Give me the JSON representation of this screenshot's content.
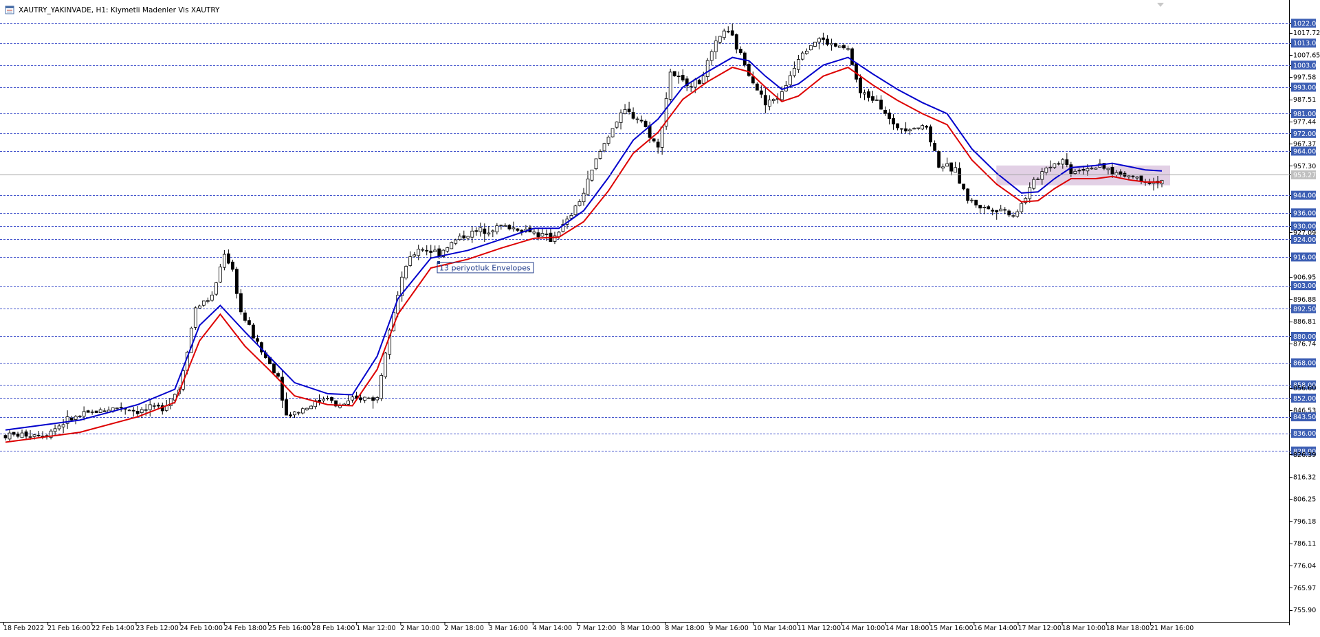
{
  "window": {
    "title": "XAUTRY_YAKINVADE, H1:  Kiymetli Madenler Vis XAUTRY",
    "title_icon": "chart-window-icon"
  },
  "colors": {
    "background": "#ffffff",
    "bull_candle": "#ffffff",
    "bear_candle": "#000000",
    "candle_outline": "#000000",
    "upper_envelope": "#0000cc",
    "lower_envelope": "#dd0000",
    "level_lines": "#4455cc",
    "price_highlight": "#3d5fb4",
    "current_price_line": "#a0a0a0",
    "current_price_box": "#c0c0c0",
    "zone_fill": "#d8c0dc"
  },
  "chart_data": {
    "type": "candlestick",
    "symbol": "XAUTRY_YAKINVADE",
    "timeframe": "H1",
    "ylim": [
      750.5,
      1026.0
    ],
    "grid": false,
    "x_labels": [
      "18 Feb 2022",
      "21 Feb 16:00",
      "22 Feb 14:00",
      "23 Feb 12:00",
      "24 Feb 10:00",
      "24 Feb 18:00",
      "25 Feb 16:00",
      "28 Feb 14:00",
      "1 Mar 12:00",
      "2 Mar 10:00",
      "2 Mar 18:00",
      "3 Mar 16:00",
      "4 Mar 14:00",
      "7 Mar 12:00",
      "8 Mar 10:00",
      "8 Mar 18:00",
      "9 Mar 16:00",
      "10 Mar 14:00",
      "11 Mar 12:00",
      "14 Mar 10:00",
      "14 Mar 18:00",
      "15 Mar 16:00",
      "16 Mar 14:00",
      "17 Mar 12:00",
      "18 Mar 10:00",
      "18 Mar 18:00",
      "21 Mar 16:00"
    ],
    "y_ticks": [
      "1022.00",
      "1017.72",
      "1013.00",
      "1007.65",
      "1003.00",
      "997.58",
      "993.00",
      "987.51",
      "981.00",
      "977.44",
      "972.00",
      "967.37",
      "964.00",
      "957.30",
      "953.27",
      "944.00",
      "936.00",
      "930.00",
      "927.09",
      "924.00",
      "916.00",
      "906.95",
      "903.00",
      "896.88",
      "892.50",
      "886.81",
      "880.00",
      "876.74",
      "868.00",
      "858.00",
      "856.60",
      "852.00",
      "846.53",
      "843.50",
      "836.00",
      "828.00",
      "826.39",
      "816.32",
      "806.25",
      "796.18",
      "786.11",
      "776.04",
      "765.97",
      "755.90"
    ],
    "highlighted_levels": [
      "1022.00",
      "1013.00",
      "1003.00",
      "993.00",
      "981.00",
      "972.00",
      "964.00",
      "944.00",
      "936.00",
      "930.00",
      "924.00",
      "916.00",
      "903.00",
      "892.50",
      "880.00",
      "868.00",
      "858.00",
      "852.00",
      "843.50",
      "836.00",
      "828.00"
    ],
    "current_price": "953.27",
    "annotation": "13 periyotluk Envelopes",
    "zone": {
      "from_label": "16 Mar 14:00",
      "to_label": "21 Mar 16:00",
      "y_range": [
        948.5,
        957.5
      ]
    },
    "key_points": [
      [
        0,
        835
      ],
      [
        10,
        836
      ],
      [
        15,
        842
      ],
      [
        22,
        846
      ],
      [
        28,
        848
      ],
      [
        32,
        846
      ],
      [
        38,
        848
      ],
      [
        42,
        856
      ],
      [
        46,
        893
      ],
      [
        50,
        898
      ],
      [
        53,
        918
      ],
      [
        55,
        910
      ],
      [
        57,
        891
      ],
      [
        62,
        873
      ],
      [
        66,
        862
      ],
      [
        68,
        844
      ],
      [
        73,
        848
      ],
      [
        78,
        853
      ],
      [
        80,
        848
      ],
      [
        86,
        852
      ],
      [
        90,
        852
      ],
      [
        93,
        885
      ],
      [
        97,
        912
      ],
      [
        100,
        920
      ],
      [
        105,
        918
      ],
      [
        110,
        925
      ],
      [
        115,
        928
      ],
      [
        120,
        930
      ],
      [
        127,
        928
      ],
      [
        132,
        924
      ],
      [
        136,
        932
      ],
      [
        140,
        945
      ],
      [
        143,
        960
      ],
      [
        147,
        975
      ],
      [
        150,
        982
      ],
      [
        154,
        978
      ],
      [
        158,
        965
      ],
      [
        161,
        1000
      ],
      [
        164,
        995
      ],
      [
        168,
        995
      ],
      [
        172,
        1012
      ],
      [
        174,
        1019
      ],
      [
        176,
        1015
      ],
      [
        180,
        1000
      ],
      [
        184,
        985
      ],
      [
        188,
        990
      ],
      [
        191,
        1003
      ],
      [
        193,
        1010
      ],
      [
        197,
        1015
      ],
      [
        200,
        1012
      ],
      [
        204,
        1010
      ],
      [
        207,
        990
      ],
      [
        211,
        988
      ],
      [
        215,
        975
      ],
      [
        219,
        975
      ],
      [
        223,
        975
      ],
      [
        226,
        958
      ],
      [
        230,
        955
      ],
      [
        233,
        942
      ],
      [
        237,
        938
      ],
      [
        241,
        938
      ],
      [
        244,
        935
      ],
      [
        246,
        940
      ],
      [
        249,
        950
      ],
      [
        252,
        957
      ],
      [
        256,
        960
      ],
      [
        258,
        955
      ],
      [
        263,
        957
      ],
      [
        266,
        956
      ],
      [
        269,
        954
      ],
      [
        274,
        952
      ],
      [
        278,
        950
      ],
      [
        280,
        951
      ]
    ],
    "series": [
      {
        "name": "upper",
        "color": "#0000cc",
        "values": [
          [
            0,
            837.5
          ],
          [
            18,
            842.0
          ],
          [
            32,
            849.0
          ],
          [
            41,
            856.0
          ],
          [
            47,
            885.0
          ],
          [
            52,
            894.0
          ],
          [
            58,
            882.0
          ],
          [
            64,
            870.5
          ],
          [
            70,
            859.0
          ],
          [
            78,
            854.0
          ],
          [
            84,
            853.5
          ],
          [
            90,
            871.0
          ],
          [
            95,
            897.0
          ],
          [
            103,
            915.5
          ],
          [
            112,
            919.0
          ],
          [
            120,
            924.0
          ],
          [
            128,
            929.0
          ],
          [
            134,
            929.0
          ],
          [
            140,
            937.0
          ],
          [
            146,
            952.0
          ],
          [
            152,
            969.0
          ],
          [
            158,
            978.5
          ],
          [
            164,
            993.0
          ],
          [
            170,
            1000.0
          ],
          [
            176,
            1006.5
          ],
          [
            180,
            1005.0
          ],
          [
            184,
            998.0
          ],
          [
            188,
            992.0
          ],
          [
            192,
            994.5
          ],
          [
            198,
            1003.0
          ],
          [
            204,
            1006.5
          ],
          [
            210,
            999.0
          ],
          [
            216,
            992.0
          ],
          [
            222,
            986.0
          ],
          [
            228,
            981.0
          ],
          [
            234,
            965.0
          ],
          [
            240,
            954.0
          ],
          [
            246,
            945.0
          ],
          [
            250,
            945.5
          ],
          [
            254,
            951.5
          ],
          [
            258,
            956.5
          ],
          [
            264,
            957.5
          ],
          [
            268,
            958.5
          ],
          [
            272,
            957.0
          ],
          [
            276,
            955.5
          ],
          [
            280,
            955.0
          ]
        ]
      },
      {
        "name": "lower",
        "color": "#dd0000",
        "values": [
          [
            0,
            832.0
          ],
          [
            18,
            836.5
          ],
          [
            32,
            843.5
          ],
          [
            41,
            850.0
          ],
          [
            47,
            878.0
          ],
          [
            52,
            890.0
          ],
          [
            58,
            875.5
          ],
          [
            64,
            864.5
          ],
          [
            70,
            853.0
          ],
          [
            78,
            849.0
          ],
          [
            84,
            848.5
          ],
          [
            90,
            865.0
          ],
          [
            95,
            890.0
          ],
          [
            103,
            911.0
          ],
          [
            112,
            915.0
          ],
          [
            120,
            920.0
          ],
          [
            128,
            924.5
          ],
          [
            134,
            925.0
          ],
          [
            140,
            932.0
          ],
          [
            146,
            946.0
          ],
          [
            152,
            963.0
          ],
          [
            158,
            972.5
          ],
          [
            164,
            987.5
          ],
          [
            170,
            995.5
          ],
          [
            176,
            1002.0
          ],
          [
            180,
            1000.0
          ],
          [
            184,
            993.0
          ],
          [
            188,
            986.5
          ],
          [
            192,
            989.0
          ],
          [
            198,
            998.0
          ],
          [
            204,
            1002.0
          ],
          [
            210,
            994.0
          ],
          [
            216,
            987.0
          ],
          [
            222,
            981.0
          ],
          [
            228,
            976.0
          ],
          [
            234,
            960.0
          ],
          [
            240,
            949.0
          ],
          [
            246,
            941.0
          ],
          [
            250,
            941.5
          ],
          [
            254,
            947.0
          ],
          [
            258,
            951.5
          ],
          [
            264,
            951.5
          ],
          [
            268,
            952.5
          ],
          [
            272,
            951.0
          ],
          [
            276,
            950.0
          ],
          [
            280,
            950.0
          ]
        ]
      }
    ]
  }
}
